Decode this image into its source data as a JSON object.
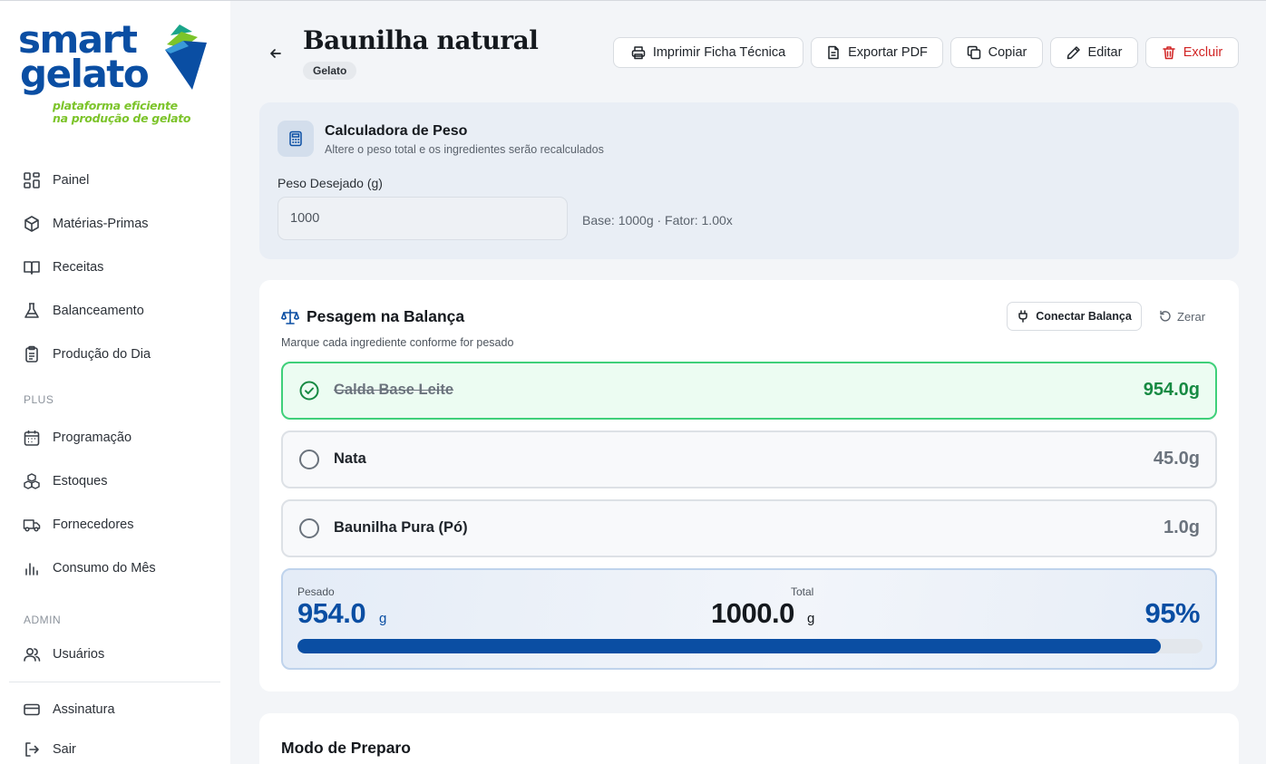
{
  "logo": {
    "line1": "smart",
    "line2": "gelato",
    "tagline1": "plataforma eficiente",
    "tagline2": "na produção de gelato"
  },
  "sidebar": {
    "items": [
      {
        "label": "Painel",
        "icon": "dashboard-icon"
      },
      {
        "label": "Matérias-Primas",
        "icon": "box-icon"
      },
      {
        "label": "Receitas",
        "icon": "book-icon"
      },
      {
        "label": "Balanceamento",
        "icon": "flask-icon"
      },
      {
        "label": "Produção do Dia",
        "icon": "clipboard-icon"
      }
    ],
    "section_plus": "PLUS",
    "plus_items": [
      {
        "label": "Programação",
        "icon": "calendar-icon"
      },
      {
        "label": "Estoques",
        "icon": "boxes-icon"
      },
      {
        "label": "Fornecedores",
        "icon": "truck-icon"
      },
      {
        "label": "Consumo do Mês",
        "icon": "bar-chart-icon"
      }
    ],
    "section_admin": "ADMIN",
    "admin_items": [
      {
        "label": "Usuários",
        "icon": "users-icon"
      }
    ],
    "footer_items": [
      {
        "label": "Assinatura",
        "icon": "credit-card-icon"
      },
      {
        "label": "Sair",
        "icon": "logout-icon"
      }
    ]
  },
  "header": {
    "title": "Baunilha natural",
    "category": "Gelato",
    "buttons": {
      "print": "Imprimir Ficha Técnica",
      "export": "Exportar PDF",
      "copy": "Copiar",
      "edit": "Editar",
      "delete": "Excluir"
    }
  },
  "calculator": {
    "title": "Calculadora de Peso",
    "subtitle": "Altere o peso total e os ingredientes serão recalculados",
    "field_label": "Peso Desejado (g)",
    "field_value": "1000",
    "base_info": "Base: 1000g · Fator: 1.00x"
  },
  "scale": {
    "title": "Pesagem na Balança",
    "subtitle": "Marque cada ingrediente conforme for pesado",
    "connect_label": "Conectar Balança",
    "reset_label": "Zerar",
    "ingredients": [
      {
        "name": "Calda Base Leite",
        "qty": "954.0g",
        "checked": true
      },
      {
        "name": "Nata",
        "qty": "45.0g",
        "checked": false
      },
      {
        "name": "Baunilha Pura (Pó)",
        "qty": "1.0g",
        "checked": false
      }
    ],
    "summary": {
      "weighed_label": "Pesado",
      "weighed_value": "954.0",
      "weighed_unit": "g",
      "total_label": "Total",
      "total_value": "1000.0",
      "total_unit": "g",
      "percent": "95%",
      "progress_fraction": 0.954
    }
  },
  "preparation": {
    "title": "Modo de Preparo"
  },
  "colors": {
    "brand_blue": "#0a4ea3",
    "brand_green": "#7cc42a",
    "success": "#178a43",
    "danger": "#d12424"
  }
}
